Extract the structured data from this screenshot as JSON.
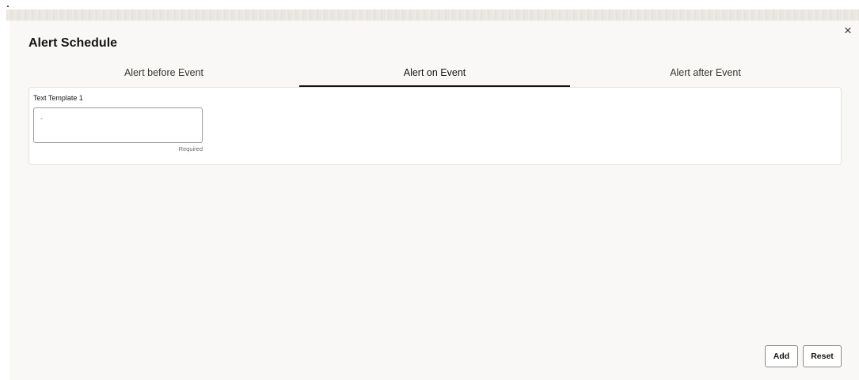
{
  "dialog": {
    "title": "Alert Schedule",
    "close_symbol": "×"
  },
  "tabs": [
    {
      "label": "Alert before Event",
      "active": false
    },
    {
      "label": "Alert on Event",
      "active": true
    },
    {
      "label": "Alert after Event",
      "active": false
    }
  ],
  "form": {
    "field_label": "Text Template 1",
    "field_value": "-",
    "field_hint": "Required"
  },
  "actions": {
    "add_label": "Add",
    "reset_label": "Reset"
  }
}
